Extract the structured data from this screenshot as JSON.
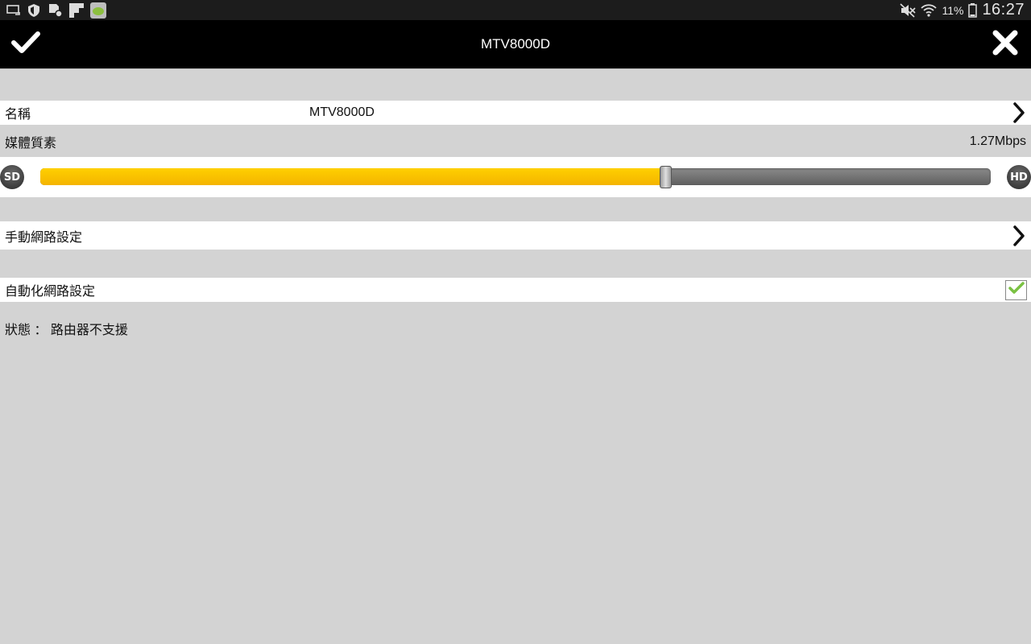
{
  "statusbar": {
    "left_icons": [
      "cast-icon",
      "shield-icon",
      "sd-card-settings-icon",
      "flipboard-icon",
      "app-icon"
    ],
    "right_icons": [
      "mute-icon",
      "wifi-icon",
      "battery-icon"
    ],
    "battery_percent": "11%",
    "clock": "16:27"
  },
  "actionbar": {
    "title": "MTV8000D",
    "confirm_icon": "checkmark-icon",
    "cancel_icon": "close-icon"
  },
  "settings": {
    "name": {
      "label": "名稱",
      "value": "MTV8000D"
    },
    "media_quality": {
      "label": "媒體質素",
      "bitrate": "1.27Mbps",
      "min_label": "SD",
      "max_label": "HD",
      "level": 0.658
    },
    "manual_network": {
      "label": "手動網路設定"
    },
    "auto_network": {
      "label": "自動化網路設定",
      "checked": true
    },
    "status": {
      "text": "狀態 ： 路由器不支援"
    }
  },
  "colors": {
    "accent": "#f8c000",
    "checkmark": "#7ac142",
    "actionbar": "#000000",
    "background": "#d3d3d3"
  }
}
